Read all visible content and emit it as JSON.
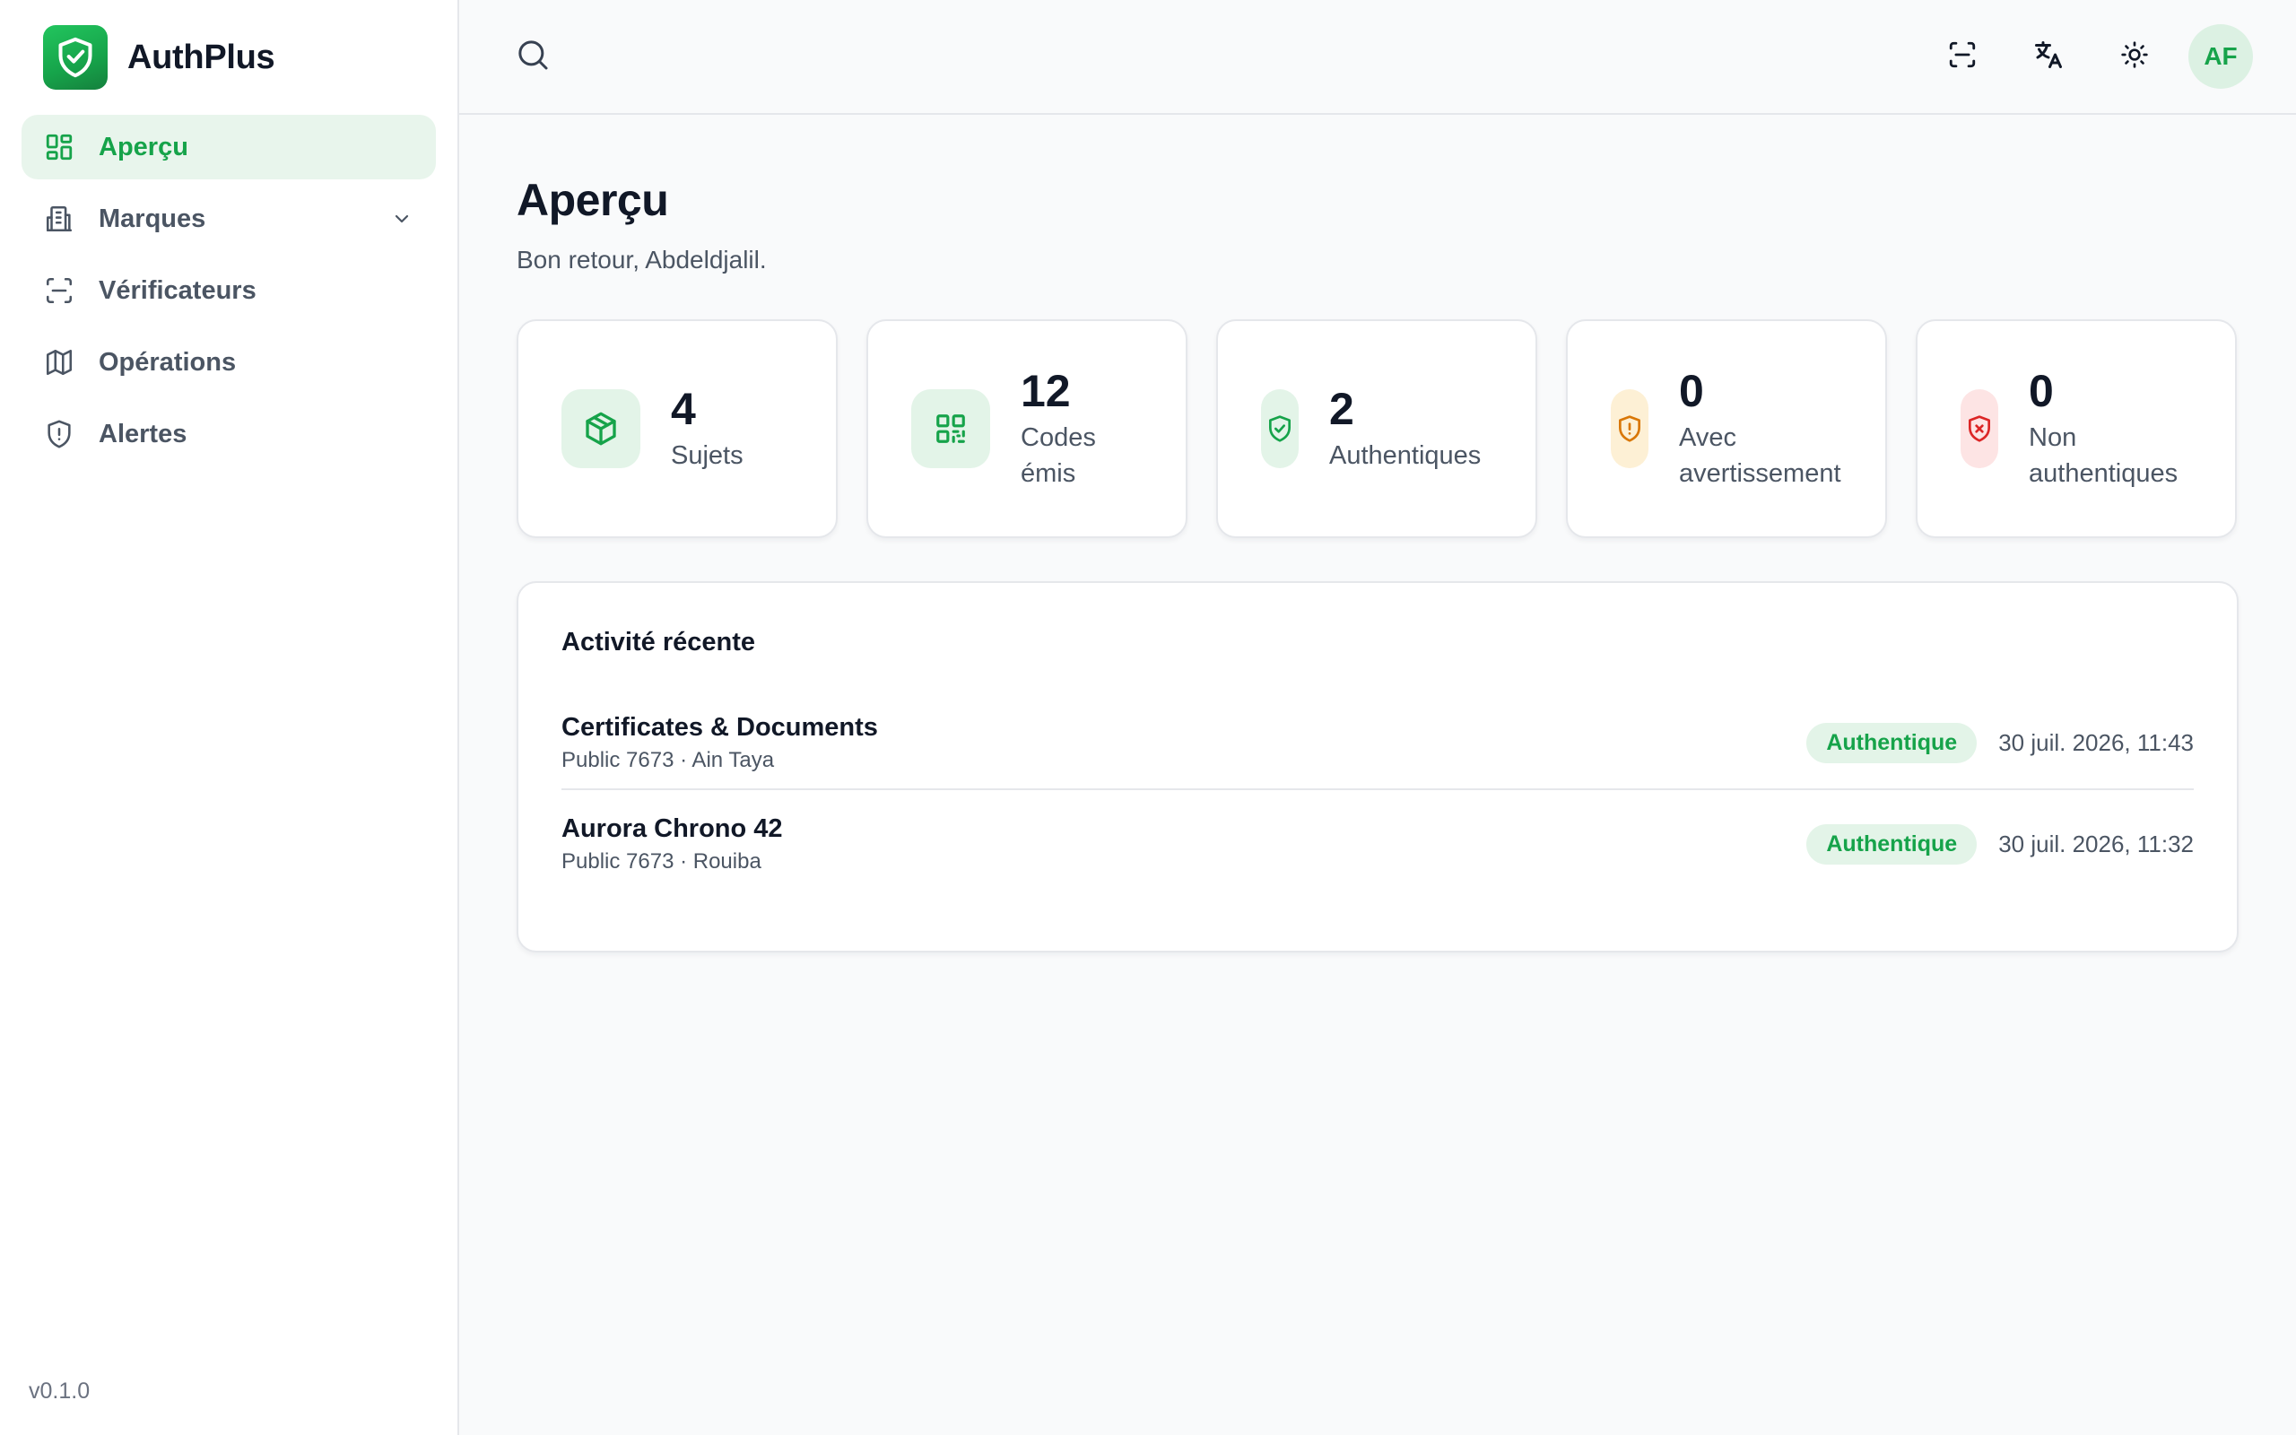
{
  "brand": {
    "name": "AuthPlus",
    "logo_icon": "shield-check-icon"
  },
  "sidebar": {
    "items": [
      {
        "label": "Aperçu",
        "icon": "dashboard-grid-icon",
        "active": true
      },
      {
        "label": "Marques",
        "icon": "building-icon",
        "active": false,
        "has_submenu": true
      },
      {
        "label": "Vérificateurs",
        "icon": "scan-icon",
        "active": false
      },
      {
        "label": "Opérations",
        "icon": "map-icon",
        "active": false
      },
      {
        "label": "Alertes",
        "icon": "shield-alert-icon",
        "active": false
      }
    ],
    "version": "v0.1.0"
  },
  "topbar": {
    "search_icon": "search-icon",
    "actions": [
      "scan-icon",
      "translate-icon",
      "sun-icon"
    ],
    "avatar_initials": "AF"
  },
  "page": {
    "title": "Aperçu",
    "subtitle": "Bon retour, Abdeldjalil."
  },
  "stats": [
    {
      "value": "4",
      "label": "Sujets",
      "icon": "box-icon",
      "color": "#16a34a",
      "bg": "#e3f4e8"
    },
    {
      "value": "12",
      "label": "Codes émis",
      "icon": "qr-code-icon",
      "color": "#16a34a",
      "bg": "#e3f4e8"
    },
    {
      "value": "2",
      "label": "Authentiques",
      "icon": "shield-check-icon",
      "color": "#16a34a",
      "bg": "#e3f4e8"
    },
    {
      "value": "0",
      "label": "Avec avertissement",
      "icon": "shield-warning-icon",
      "color": "#d97706",
      "bg": "#fdf0d5"
    },
    {
      "value": "0",
      "label": "Non authentiques",
      "icon": "shield-x-icon",
      "color": "#dc2626",
      "bg": "#fde4e4"
    }
  ],
  "activity": {
    "title": "Activité récente",
    "rows": [
      {
        "title": "Certificates & Documents",
        "subtitle": "Public 7673 · Ain Taya",
        "status": "Authentique",
        "time": "30 juil. 2026, 11:43"
      },
      {
        "title": "Aurora Chrono 42",
        "subtitle": "Public 7673 · Rouiba",
        "status": "Authentique",
        "time": "30 juil. 2026, 11:32"
      }
    ]
  },
  "colors": {
    "accent": "#16a34a",
    "accent_soft": "#e8f5ec",
    "warning": "#d97706",
    "danger": "#dc2626"
  }
}
